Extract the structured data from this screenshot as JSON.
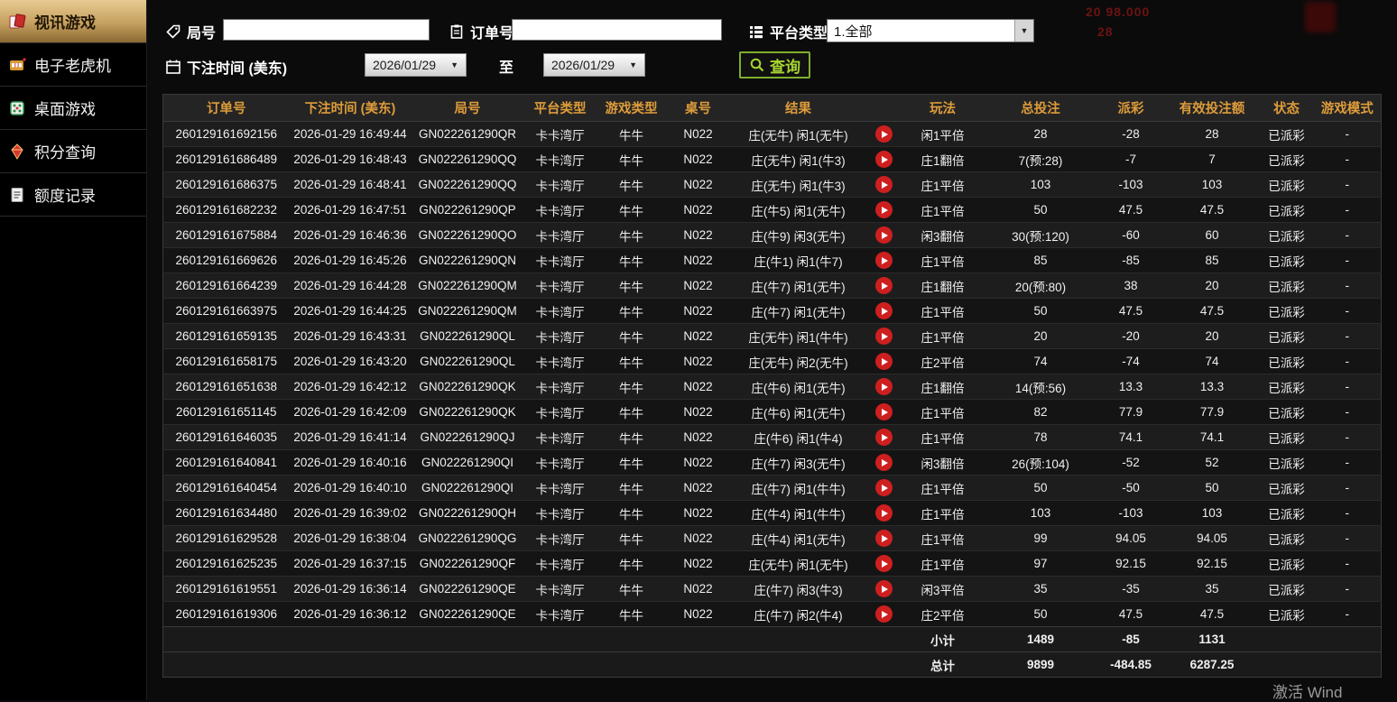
{
  "sidebar": {
    "items": [
      {
        "id": "video-games",
        "label": "视讯游戏",
        "icon": "cards-icon",
        "active": true
      },
      {
        "id": "slot-machines",
        "label": "电子老虎机",
        "icon": "slot-icon",
        "active": false
      },
      {
        "id": "table-games",
        "label": "桌面游戏",
        "icon": "dice-icon",
        "active": false
      },
      {
        "id": "points-query",
        "label": "积分查询",
        "icon": "gem-icon",
        "active": false
      },
      {
        "id": "quota-records",
        "label": "额度记录",
        "icon": "ledger-icon",
        "active": false
      }
    ]
  },
  "filters": {
    "round_label": "局号",
    "order_label": "订单号",
    "platform_label": "平台类型",
    "platform_value": "1.全部",
    "bet_time_label": "下注时间 (美东)",
    "date_from": "2026/01/29",
    "to_label": "至",
    "date_to": "2026/01/29",
    "search_label": "查询"
  },
  "table": {
    "headers": [
      "订单号",
      "下注时间 (美东)",
      "局号",
      "平台类型",
      "游戏类型",
      "桌号",
      "结果",
      "玩法",
      "总投注",
      "派彩",
      "有效投注额",
      "状态",
      "游戏模式"
    ],
    "rows": [
      [
        "260129161692156",
        "2026-01-29 16:49:44",
        "GN022261290QR",
        "卡卡湾厅",
        "牛牛",
        "N022",
        "庄(无牛) 闲1(无牛)",
        "闲1平倍",
        "28",
        "-28",
        "28",
        "已派彩",
        "-"
      ],
      [
        "260129161686489",
        "2026-01-29 16:48:43",
        "GN022261290QQ",
        "卡卡湾厅",
        "牛牛",
        "N022",
        "庄(无牛) 闲1(牛3)",
        "庄1翻倍",
        "7(预:28)",
        "-7",
        "7",
        "已派彩",
        "-"
      ],
      [
        "260129161686375",
        "2026-01-29 16:48:41",
        "GN022261290QQ",
        "卡卡湾厅",
        "牛牛",
        "N022",
        "庄(无牛) 闲1(牛3)",
        "庄1平倍",
        "103",
        "-103",
        "103",
        "已派彩",
        "-"
      ],
      [
        "260129161682232",
        "2026-01-29 16:47:51",
        "GN022261290QP",
        "卡卡湾厅",
        "牛牛",
        "N022",
        "庄(牛5) 闲1(无牛)",
        "庄1平倍",
        "50",
        "47.5",
        "47.5",
        "已派彩",
        "-"
      ],
      [
        "260129161675884",
        "2026-01-29 16:46:36",
        "GN022261290QO",
        "卡卡湾厅",
        "牛牛",
        "N022",
        "庄(牛9) 闲3(无牛)",
        "闲3翻倍",
        "30(预:120)",
        "-60",
        "60",
        "已派彩",
        "-"
      ],
      [
        "260129161669626",
        "2026-01-29 16:45:26",
        "GN022261290QN",
        "卡卡湾厅",
        "牛牛",
        "N022",
        "庄(牛1) 闲1(牛7)",
        "庄1平倍",
        "85",
        "-85",
        "85",
        "已派彩",
        "-"
      ],
      [
        "260129161664239",
        "2026-01-29 16:44:28",
        "GN022261290QM",
        "卡卡湾厅",
        "牛牛",
        "N022",
        "庄(牛7) 闲1(无牛)",
        "庄1翻倍",
        "20(预:80)",
        "38",
        "20",
        "已派彩",
        "-"
      ],
      [
        "260129161663975",
        "2026-01-29 16:44:25",
        "GN022261290QM",
        "卡卡湾厅",
        "牛牛",
        "N022",
        "庄(牛7) 闲1(无牛)",
        "庄1平倍",
        "50",
        "47.5",
        "47.5",
        "已派彩",
        "-"
      ],
      [
        "260129161659135",
        "2026-01-29 16:43:31",
        "GN022261290QL",
        "卡卡湾厅",
        "牛牛",
        "N022",
        "庄(无牛) 闲1(牛牛)",
        "庄1平倍",
        "20",
        "-20",
        "20",
        "已派彩",
        "-"
      ],
      [
        "260129161658175",
        "2026-01-29 16:43:20",
        "GN022261290QL",
        "卡卡湾厅",
        "牛牛",
        "N022",
        "庄(无牛) 闲2(无牛)",
        "庄2平倍",
        "74",
        "-74",
        "74",
        "已派彩",
        "-"
      ],
      [
        "260129161651638",
        "2026-01-29 16:42:12",
        "GN022261290QK",
        "卡卡湾厅",
        "牛牛",
        "N022",
        "庄(牛6) 闲1(无牛)",
        "庄1翻倍",
        "14(预:56)",
        "13.3",
        "13.3",
        "已派彩",
        "-"
      ],
      [
        "260129161651145",
        "2026-01-29 16:42:09",
        "GN022261290QK",
        "卡卡湾厅",
        "牛牛",
        "N022",
        "庄(牛6) 闲1(无牛)",
        "庄1平倍",
        "82",
        "77.9",
        "77.9",
        "已派彩",
        "-"
      ],
      [
        "260129161646035",
        "2026-01-29 16:41:14",
        "GN022261290QJ",
        "卡卡湾厅",
        "牛牛",
        "N022",
        "庄(牛6) 闲1(牛4)",
        "庄1平倍",
        "78",
        "74.1",
        "74.1",
        "已派彩",
        "-"
      ],
      [
        "260129161640841",
        "2026-01-29 16:40:16",
        "GN022261290QI",
        "卡卡湾厅",
        "牛牛",
        "N022",
        "庄(牛7) 闲3(无牛)",
        "闲3翻倍",
        "26(预:104)",
        "-52",
        "52",
        "已派彩",
        "-"
      ],
      [
        "260129161640454",
        "2026-01-29 16:40:10",
        "GN022261290QI",
        "卡卡湾厅",
        "牛牛",
        "N022",
        "庄(牛7) 闲1(牛牛)",
        "庄1平倍",
        "50",
        "-50",
        "50",
        "已派彩",
        "-"
      ],
      [
        "260129161634480",
        "2026-01-29 16:39:02",
        "GN022261290QH",
        "卡卡湾厅",
        "牛牛",
        "N022",
        "庄(牛4) 闲1(牛牛)",
        "庄1平倍",
        "103",
        "-103",
        "103",
        "已派彩",
        "-"
      ],
      [
        "260129161629528",
        "2026-01-29 16:38:04",
        "GN022261290QG",
        "卡卡湾厅",
        "牛牛",
        "N022",
        "庄(牛4) 闲1(无牛)",
        "庄1平倍",
        "99",
        "94.05",
        "94.05",
        "已派彩",
        "-"
      ],
      [
        "260129161625235",
        "2026-01-29 16:37:15",
        "GN022261290QF",
        "卡卡湾厅",
        "牛牛",
        "N022",
        "庄(无牛) 闲1(无牛)",
        "庄1平倍",
        "97",
        "92.15",
        "92.15",
        "已派彩",
        "-"
      ],
      [
        "260129161619551",
        "2026-01-29 16:36:14",
        "GN022261290QE",
        "卡卡湾厅",
        "牛牛",
        "N022",
        "庄(牛7) 闲3(牛3)",
        "闲3平倍",
        "35",
        "-35",
        "35",
        "已派彩",
        "-"
      ],
      [
        "260129161619306",
        "2026-01-29 16:36:12",
        "GN022261290QE",
        "卡卡湾厅",
        "牛牛",
        "N022",
        "庄(牛7) 闲2(牛4)",
        "庄2平倍",
        "50",
        "47.5",
        "47.5",
        "已派彩",
        "-"
      ]
    ],
    "subtotal": {
      "label": "小计",
      "total_bet": "1489",
      "payout": "-85",
      "valid_bet": "1131"
    },
    "total": {
      "label": "总计",
      "total_bet": "9899",
      "payout": "-484.85",
      "valid_bet": "6287.25"
    }
  },
  "ghost": {
    "line1": "20  98.000",
    "line2": "28"
  },
  "watermark": "激活 Wind",
  "colors": {
    "header_text": "#df9c3a",
    "payout_negative": "#52e242",
    "payout_positive": "#9c1717",
    "status_paid": "#2fd32f",
    "footer_number": "#ffd83a",
    "search_green": "#a6d431",
    "active_item_gold": "#c5a05f",
    "play_button_red": "#ce1f1f"
  }
}
